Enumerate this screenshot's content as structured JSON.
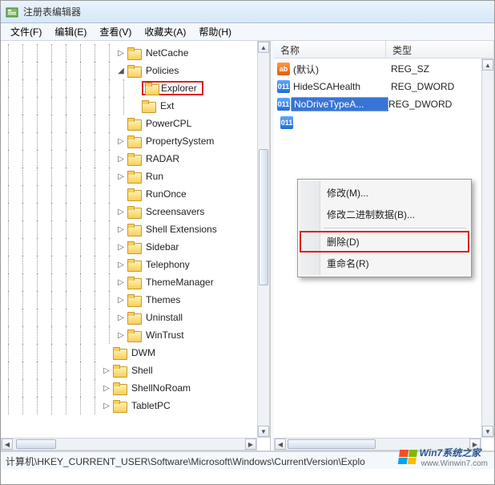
{
  "window": {
    "title": "注册表编辑器"
  },
  "menu": {
    "file": "文件(F)",
    "edit": "编辑(E)",
    "view": "查看(V)",
    "favorites": "收藏夹(A)",
    "help": "帮助(H)"
  },
  "tree": {
    "items": [
      {
        "depth": 8,
        "exp": "▷",
        "label": "NetCache"
      },
      {
        "depth": 8,
        "exp": "◢",
        "label": "Policies"
      },
      {
        "depth": 9,
        "exp": "",
        "label": "Explorer",
        "highlighted": true
      },
      {
        "depth": 9,
        "exp": "",
        "label": "Ext"
      },
      {
        "depth": 8,
        "exp": "",
        "label": "PowerCPL"
      },
      {
        "depth": 8,
        "exp": "▷",
        "label": "PropertySystem"
      },
      {
        "depth": 8,
        "exp": "▷",
        "label": "RADAR"
      },
      {
        "depth": 8,
        "exp": "▷",
        "label": "Run"
      },
      {
        "depth": 8,
        "exp": "",
        "label": "RunOnce"
      },
      {
        "depth": 8,
        "exp": "▷",
        "label": "Screensavers"
      },
      {
        "depth": 8,
        "exp": "▷",
        "label": "Shell Extensions"
      },
      {
        "depth": 8,
        "exp": "▷",
        "label": "Sidebar"
      },
      {
        "depth": 8,
        "exp": "▷",
        "label": "Telephony"
      },
      {
        "depth": 8,
        "exp": "▷",
        "label": "ThemeManager"
      },
      {
        "depth": 8,
        "exp": "▷",
        "label": "Themes"
      },
      {
        "depth": 8,
        "exp": "▷",
        "label": "Uninstall"
      },
      {
        "depth": 8,
        "exp": "▷",
        "label": "WinTrust"
      },
      {
        "depth": 7,
        "exp": "",
        "label": "DWM"
      },
      {
        "depth": 7,
        "exp": "▷",
        "label": "Shell"
      },
      {
        "depth": 7,
        "exp": "▷",
        "label": "ShellNoRoam"
      },
      {
        "depth": 7,
        "exp": "▷",
        "label": "TabletPC"
      }
    ]
  },
  "list": {
    "headers": {
      "name": "名称",
      "type": "类型"
    },
    "rows": [
      {
        "iconType": "str",
        "iconText": "ab",
        "name": "(默认)",
        "type": "REG_SZ"
      },
      {
        "iconType": "dword",
        "iconText": "011",
        "name": "HideSCAHealth",
        "type": "REG_DWORD"
      },
      {
        "iconType": "dword",
        "iconText": "011",
        "name": "NoDriveTypeA...",
        "type": "REG_DWORD",
        "selected": true
      }
    ],
    "extraIconText": "011"
  },
  "contextMenu": {
    "modify": "修改(M)...",
    "modifyBinary": "修改二进制数据(B)...",
    "delete": "删除(D)",
    "rename": "重命名(R)"
  },
  "statusbar": "计算机\\HKEY_CURRENT_USER\\Software\\Microsoft\\Windows\\CurrentVersion\\Explo",
  "watermark": {
    "main": "Win7系统之家",
    "sub": "www.Winwin7.com"
  }
}
